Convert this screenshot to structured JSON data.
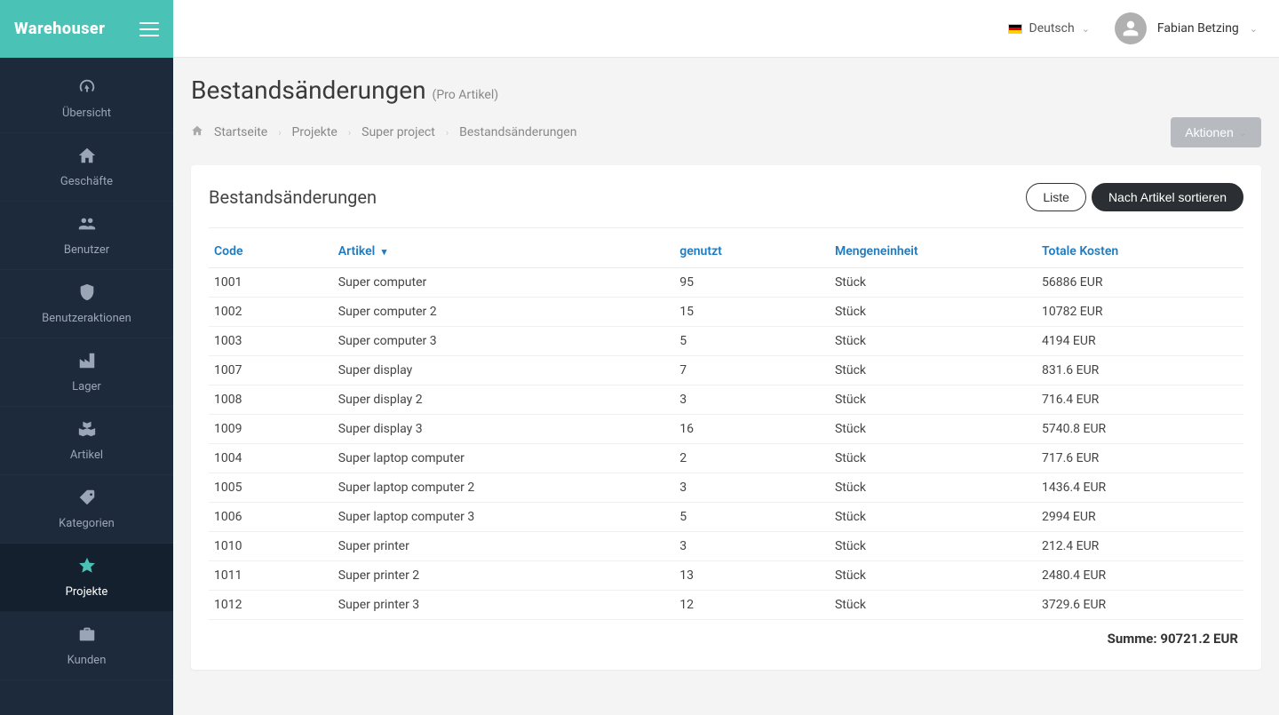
{
  "brand": "Warehouser",
  "topbar": {
    "language": "Deutsch",
    "user_name": "Fabian Betzing"
  },
  "sidebar": {
    "items": [
      {
        "label": "Übersicht",
        "icon": "dashboard"
      },
      {
        "label": "Geschäfte",
        "icon": "home"
      },
      {
        "label": "Benutzer",
        "icon": "users"
      },
      {
        "label": "Benutzeraktionen",
        "icon": "shield"
      },
      {
        "label": "Lager",
        "icon": "industry"
      },
      {
        "label": "Artikel",
        "icon": "boxes"
      },
      {
        "label": "Kategorien",
        "icon": "tag"
      },
      {
        "label": "Projekte",
        "icon": "star",
        "active": true
      },
      {
        "label": "Kunden",
        "icon": "briefcase"
      }
    ]
  },
  "page": {
    "title": "Bestandsänderungen",
    "subtitle": "(Pro Artikel)"
  },
  "breadcrumbs": {
    "items": [
      "Startseite",
      "Projekte",
      "Super project",
      "Bestandsänderungen"
    ]
  },
  "actions_label": "Aktionen",
  "card": {
    "title": "Bestandsänderungen",
    "view_list": "Liste",
    "view_by_article": "Nach Artikel sortieren"
  },
  "table": {
    "headers": {
      "code": "Code",
      "article": "Artikel",
      "used": "genutzt",
      "unit": "Mengeneinheit",
      "total": "Totale Kosten"
    },
    "rows": [
      {
        "code": "1001",
        "article": "Super computer",
        "used": "95",
        "unit": "Stück",
        "total": "56886 EUR"
      },
      {
        "code": "1002",
        "article": "Super computer 2",
        "used": "15",
        "unit": "Stück",
        "total": "10782 EUR"
      },
      {
        "code": "1003",
        "article": "Super computer 3",
        "used": "5",
        "unit": "Stück",
        "total": "4194 EUR"
      },
      {
        "code": "1007",
        "article": "Super display",
        "used": "7",
        "unit": "Stück",
        "total": "831.6 EUR"
      },
      {
        "code": "1008",
        "article": "Super display 2",
        "used": "3",
        "unit": "Stück",
        "total": "716.4 EUR"
      },
      {
        "code": "1009",
        "article": "Super display 3",
        "used": "16",
        "unit": "Stück",
        "total": "5740.8 EUR"
      },
      {
        "code": "1004",
        "article": "Super laptop computer",
        "used": "2",
        "unit": "Stück",
        "total": "717.6 EUR"
      },
      {
        "code": "1005",
        "article": "Super laptop computer 2",
        "used": "3",
        "unit": "Stück",
        "total": "1436.4 EUR"
      },
      {
        "code": "1006",
        "article": "Super laptop computer 3",
        "used": "5",
        "unit": "Stück",
        "total": "2994 EUR"
      },
      {
        "code": "1010",
        "article": "Super printer",
        "used": "3",
        "unit": "Stück",
        "total": "212.4 EUR"
      },
      {
        "code": "1011",
        "article": "Super printer 2",
        "used": "13",
        "unit": "Stück",
        "total": "2480.4 EUR"
      },
      {
        "code": "1012",
        "article": "Super printer 3",
        "used": "12",
        "unit": "Stück",
        "total": "3729.6 EUR"
      }
    ],
    "sum_label": "Summe:",
    "sum_value": "90721.2 EUR"
  }
}
